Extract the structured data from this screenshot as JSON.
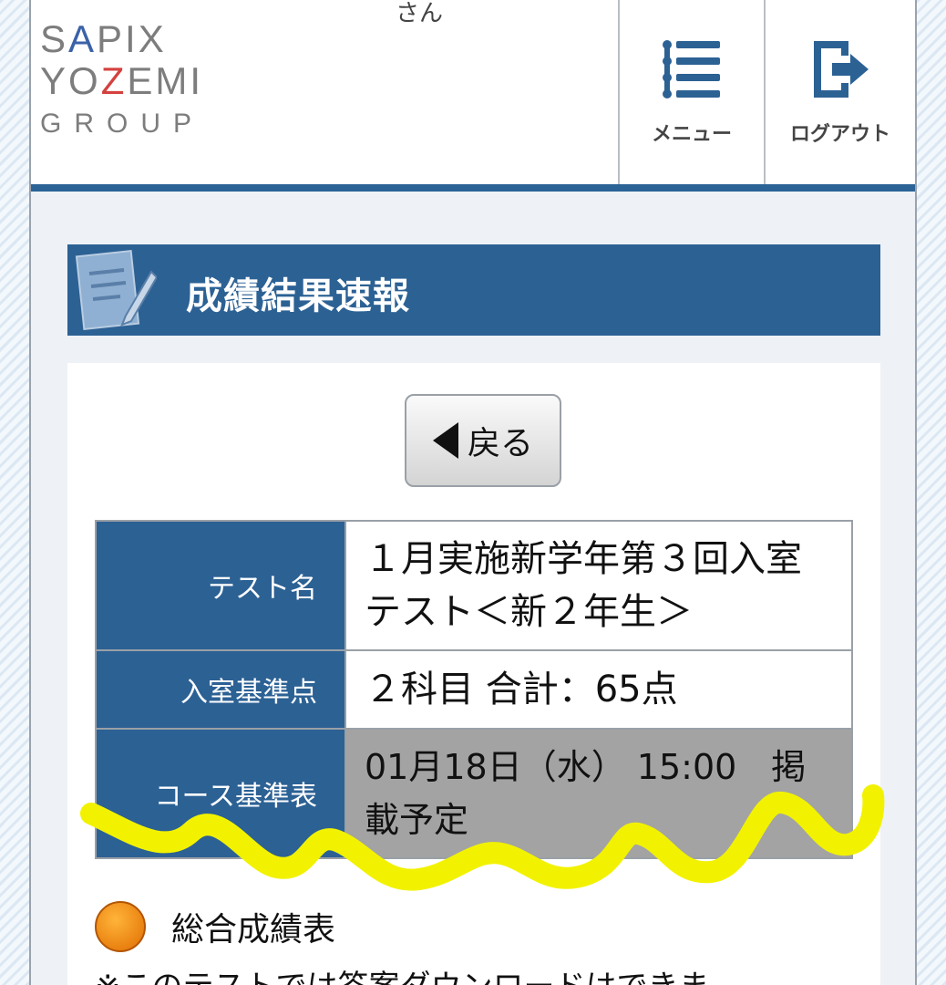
{
  "header": {
    "logo_lines": [
      "SAPIX",
      "YOZEMI",
      "GROUP"
    ],
    "user_suffix": "さん",
    "menu_label": "メニュー",
    "logout_label": "ログアウト"
  },
  "section": {
    "title": "成績結果速報"
  },
  "back_label": "戻る",
  "info_table": {
    "rows": [
      {
        "label": "テスト名",
        "value": "１月実施新学年第３回入室テスト＜新２年生＞"
      },
      {
        "label": "入室基準点",
        "value": "２科目  合計：65点"
      },
      {
        "label": "コース基準表",
        "value": "01月18日（水） 15:00　掲載予定"
      }
    ]
  },
  "links": [
    {
      "label": "総合成績表"
    }
  ],
  "note": "※このテストでは答案ダウンロードはできま",
  "colors": {
    "primary": "#2c6194",
    "header_bar": "#2b6396",
    "orange_dot": "#f08a00",
    "highlight": "#f2f200"
  }
}
